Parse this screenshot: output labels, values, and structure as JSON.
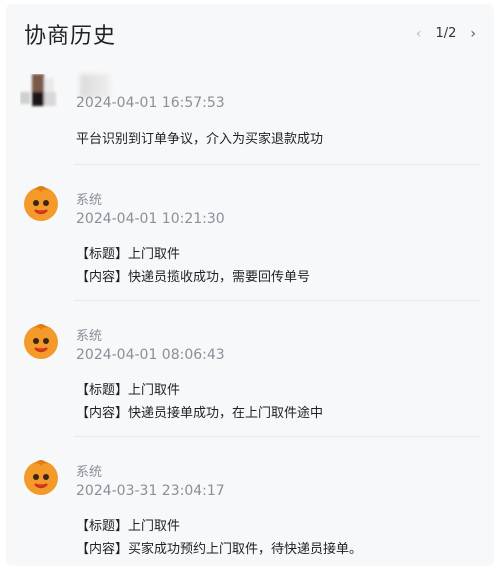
{
  "header": {
    "title": "协商历史",
    "pager": "1/2",
    "prev_icon": "‹",
    "next_icon": "›"
  },
  "entries": [
    {
      "name": "",
      "time": "2024-04-01 16:57:53",
      "lines": [
        "平台识别到订单争议，介入为买家退款成功"
      ]
    },
    {
      "name": "系统",
      "time": "2024-04-01 10:21:30",
      "lines": [
        "【标题】上门取件",
        "【内容】快递员揽收成功，需要回传单号"
      ]
    },
    {
      "name": "系统",
      "time": "2024-04-01 08:06:43",
      "lines": [
        "【标题】上门取件",
        "【内容】快递员接单成功，在上门取件途中"
      ]
    },
    {
      "name": "系统",
      "time": "2024-03-31 23:04:17",
      "lines": [
        "【标题】上门取件",
        "【内容】买家成功预约上门取件，待快递员接单。"
      ]
    }
  ],
  "colors": {
    "panel": "#f7f8fa",
    "avatar_main": "#f39a2b",
    "avatar_dark": "#e27c17",
    "text_muted": "#8a8f99"
  },
  "icons": {
    "system_avatar": "orange-mascot-avatar-icon",
    "blurred_avatar": "blurred-user-avatar-icon"
  }
}
